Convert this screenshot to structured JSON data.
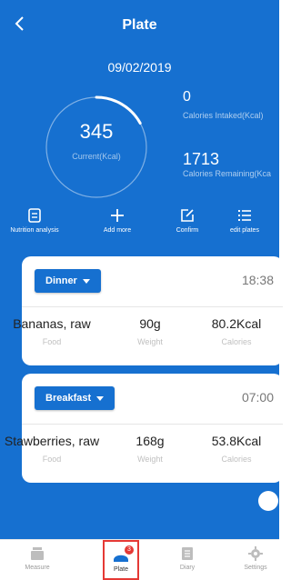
{
  "header": {
    "title": "Plate",
    "date": "09/02/2019"
  },
  "summary": {
    "current_value": "345",
    "current_label": "Current(Kcal)",
    "intaked_value": "0",
    "intaked_label": "Calories Intaked(Kcal)",
    "remaining_value": "1713",
    "remaining_label": "Calories Remaining(Kca",
    "progress_fraction": 0.17
  },
  "actions": [
    {
      "label": "Nutrition analysis",
      "icon": "document-icon"
    },
    {
      "label": "Add more",
      "icon": "plus-icon"
    },
    {
      "label": "Confirm",
      "icon": "edit-square-icon"
    },
    {
      "label": "edit plates",
      "icon": "list-icon"
    }
  ],
  "meals": [
    {
      "name": "Dinner",
      "time": "18:38",
      "food": "Bananas, raw",
      "weight": "90g",
      "calories": "80.2Kcal",
      "food_label": "Food",
      "weight_label": "Weight",
      "calories_label": "Calories"
    },
    {
      "name": "Breakfast",
      "time": "07:00",
      "food": "Stawberries, raw",
      "weight": "168g",
      "calories": "53.8Kcal",
      "food_label": "Food",
      "weight_label": "Weight",
      "calories_label": "Calories"
    }
  ],
  "bottom_nav": [
    {
      "label": "Measure",
      "icon": "scale-icon"
    },
    {
      "label": "Plate",
      "icon": "plate-icon",
      "badge": "3",
      "active": true
    },
    {
      "label": "Diary",
      "icon": "diary-icon"
    },
    {
      "label": "Settings",
      "icon": "gear-icon"
    }
  ],
  "colors": {
    "primary": "#1670d0",
    "highlight": "#e53935"
  }
}
